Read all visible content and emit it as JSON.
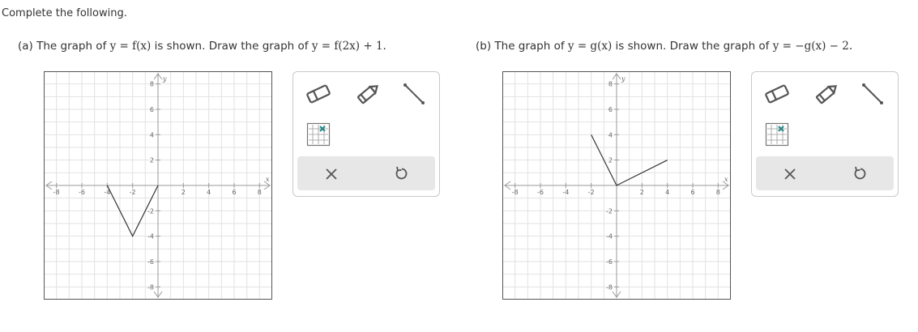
{
  "instruction": "Complete the following.",
  "parts": [
    {
      "id": "a",
      "prefix": "(a) The graph of ",
      "given": "y = f(x)",
      "middle": " is shown. Draw the graph of ",
      "target": "y = f(2x) + 1.",
      "graph": {
        "x_range": [
          -9,
          9
        ],
        "y_range": [
          -9,
          9
        ],
        "x_ticks": [
          "-8",
          "-6",
          "-4",
          "-2",
          "2",
          "4",
          "6",
          "8"
        ],
        "y_ticks": [
          "8",
          "6",
          "4",
          "2",
          "-2",
          "-4",
          "-6",
          "-8"
        ],
        "x_axis_label": "x",
        "y_axis_label": "y",
        "curve_points": [
          [
            -4,
            0
          ],
          [
            -2,
            -4
          ],
          [
            0,
            0
          ]
        ]
      }
    },
    {
      "id": "b",
      "prefix": "(b) The graph of ",
      "given": "y = g(x)",
      "middle": " is shown. Draw the graph of ",
      "target": "y = −g(x) − 2.",
      "graph": {
        "x_range": [
          -9,
          9
        ],
        "y_range": [
          -9,
          9
        ],
        "x_ticks": [
          "-8",
          "-6",
          "-4",
          "-2",
          "2",
          "4",
          "6",
          "8"
        ],
        "y_ticks": [
          "8",
          "6",
          "4",
          "2",
          "-2",
          "-4",
          "-6",
          "-8"
        ],
        "x_axis_label": "x",
        "y_axis_label": "y",
        "curve_points": [
          [
            -2,
            4
          ],
          [
            0,
            0
          ],
          [
            4,
            2
          ]
        ]
      }
    }
  ],
  "toolbox": {
    "tools": [
      "eraser-icon",
      "pencil-icon",
      "line-segment-icon",
      "grid-point-icon"
    ],
    "actions": [
      "clear-icon",
      "undo-icon"
    ]
  },
  "colors": {
    "grid": "#e2e2e2",
    "axis": "#9a9a9a",
    "curve": "#333333",
    "toolbar_bg": "#e7e7e7",
    "icon": "#555555"
  }
}
